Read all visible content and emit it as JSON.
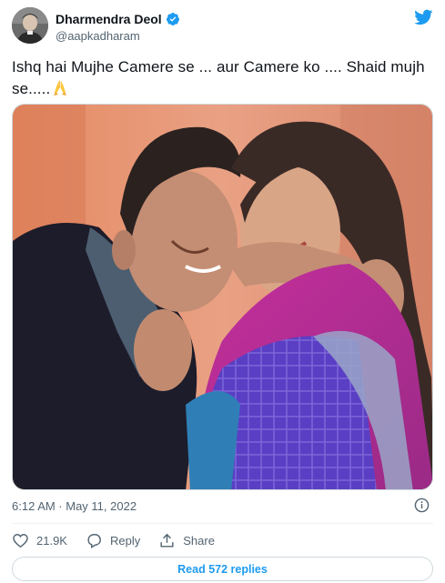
{
  "author": {
    "display_name": "Dharmendra Deol",
    "handle": "@aapkadharam",
    "verified": true,
    "avatar_icon": "avatar-photo"
  },
  "tweet": {
    "text": "Ishq hai Mujhe Camere se ... aur Camere ko .... Shaid mujh se.....",
    "emoji": "folded-hands",
    "timestamp": "6:12 AM · May 11, 2022"
  },
  "actions": {
    "like_count": "21.9K",
    "reply_label": "Reply",
    "share_label": "Share"
  },
  "read_replies": "Read 572 replies",
  "colors": {
    "twitter_blue": "#1d9bf0",
    "secondary_text": "#536471",
    "border": "#cfd9de"
  }
}
